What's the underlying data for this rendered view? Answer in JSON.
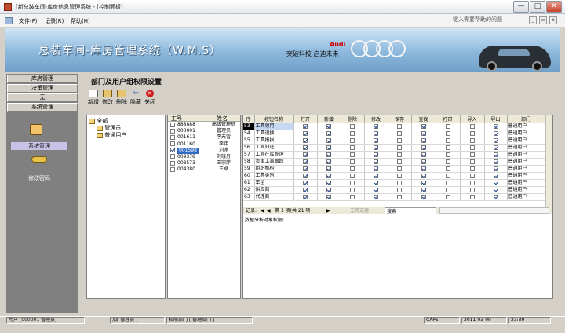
{
  "window": {
    "title": "[新总装车间-库房信息管理系统 - [控制面板]",
    "buttons": {
      "minimize": "—",
      "maximize": "□",
      "close": "✕"
    }
  },
  "menubar": {
    "items": [
      "文件(F)",
      "记录(R)",
      "帮助(H)"
    ],
    "help_placeholder": "键入需要帮助的问题",
    "mdi_buttons": [
      "_",
      "▫",
      "x"
    ]
  },
  "banner": {
    "title": "总装车间-库房管理系统（W.M.S）",
    "slogan": "突破科技  启迪未来",
    "brand": "Audi"
  },
  "nav": {
    "buttons": [
      "库房管理",
      "决策管理",
      "无",
      "系统管理"
    ],
    "icons": [
      {
        "label": "系统管理",
        "icon": "users-icon",
        "selected": true
      },
      {
        "label": "修改密码",
        "icon": "key-icon",
        "selected": false
      }
    ]
  },
  "main": {
    "heading": "部门及用户组权限设置",
    "toolbar": [
      {
        "label": "新增",
        "icon": "new-icon"
      },
      {
        "label": "修改",
        "icon": "edit-icon"
      },
      {
        "label": "删除",
        "icon": "delete-icon"
      },
      {
        "label": "隐藏",
        "icon": "hide-icon"
      },
      {
        "label": "关闭",
        "icon": "close-icon"
      }
    ]
  },
  "tree": {
    "root": "全部",
    "children": [
      "管理员",
      "普通用户"
    ]
  },
  "users": {
    "headers": [
      "工号",
      "姓名"
    ],
    "rows": [
      {
        "id": "888888",
        "name": "高级管理员",
        "checked": false,
        "selected": false
      },
      {
        "id": "000001",
        "name": "管理员",
        "checked": false,
        "selected": false
      },
      {
        "id": "001611",
        "name": "李天雪",
        "checked": false,
        "selected": false
      },
      {
        "id": "001160",
        "name": "李伟",
        "checked": false,
        "selected": false
      },
      {
        "id": "001598",
        "name": "刘冰",
        "checked": true,
        "selected": true
      },
      {
        "id": "009378",
        "name": "刘晓丹",
        "checked": false,
        "selected": false
      },
      {
        "id": "003573",
        "name": "王宗萍",
        "checked": false,
        "selected": false
      },
      {
        "id": "004380",
        "name": "王卓",
        "checked": false,
        "selected": false
      }
    ]
  },
  "perms": {
    "headers": [
      "序",
      "按钮名称",
      "打开",
      "新增",
      "删除",
      "修改",
      "保存",
      "查找",
      "打印",
      "导入",
      "导出",
      "部门"
    ],
    "rows": [
      {
        "no": "53",
        "name": "工具领用",
        "flags": [
          1,
          1,
          0,
          1,
          0,
          1,
          0,
          0,
          1
        ],
        "dept": "普通用户",
        "current": true
      },
      {
        "no": "54",
        "name": "工具退换",
        "flags": [
          1,
          1,
          0,
          1,
          0,
          1,
          0,
          0,
          1
        ],
        "dept": "普通用户",
        "current": false
      },
      {
        "no": "55",
        "name": "工具报损",
        "flags": [
          1,
          1,
          0,
          1,
          0,
          1,
          0,
          0,
          1
        ],
        "dept": "普通用户",
        "current": false
      },
      {
        "no": "56",
        "name": "工具归还",
        "flags": [
          1,
          1,
          0,
          1,
          0,
          1,
          0,
          0,
          1
        ],
        "dept": "普通用户",
        "current": false
      },
      {
        "no": "57",
        "name": "工具在库查询",
        "flags": [
          1,
          1,
          0,
          1,
          0,
          1,
          0,
          0,
          1
        ],
        "dept": "普通用户",
        "current": false
      },
      {
        "no": "58",
        "name": "贵重工具跟踪",
        "flags": [
          1,
          1,
          0,
          1,
          0,
          1,
          0,
          0,
          1
        ],
        "dept": "普通用户",
        "current": false
      },
      {
        "no": "59",
        "name": "组织机构",
        "flags": [
          1,
          1,
          0,
          1,
          0,
          1,
          0,
          0,
          1
        ],
        "dept": "普通用户",
        "current": false
      },
      {
        "no": "60",
        "name": "工具类别",
        "flags": [
          1,
          1,
          0,
          1,
          0,
          1,
          0,
          0,
          1
        ],
        "dept": "普通用户",
        "current": false
      },
      {
        "no": "61",
        "name": "车型",
        "flags": [
          1,
          1,
          0,
          1,
          0,
          1,
          0,
          0,
          1
        ],
        "dept": "普通用户",
        "current": false
      },
      {
        "no": "62",
        "name": "供应商",
        "flags": [
          1,
          1,
          0,
          1,
          0,
          1,
          0,
          0,
          1
        ],
        "dept": "普通用户",
        "current": false
      },
      {
        "no": "63",
        "name": "代理商",
        "flags": [
          1,
          1,
          0,
          1,
          0,
          1,
          0,
          0,
          1
        ],
        "dept": "普通用户",
        "current": false
      }
    ],
    "record_nav": {
      "label": "记录:",
      "position": "第 1 项(共 21 项",
      "filter": "无筛选器",
      "search": "搜索"
    },
    "analysis_label": "数据分析对象权限:"
  },
  "statusbar": {
    "cells": [
      "用户 [000001 管理员]",
      "加[ 管理员 ]",
      "权限部门 [ 管理部门 ]",
      "CAPS",
      "2011-03-09",
      "23:39"
    ]
  }
}
